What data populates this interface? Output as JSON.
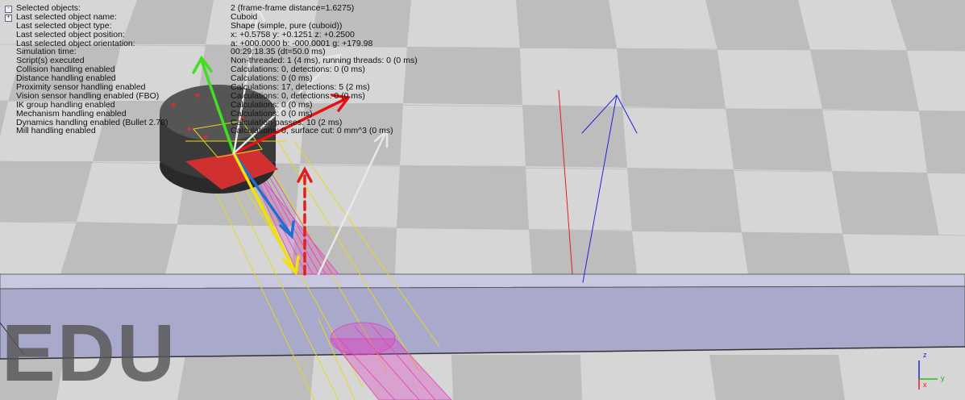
{
  "info_panel": {
    "rows": [
      {
        "label": "Selected objects:",
        "value": "2 (frame-frame distance=1.6275)",
        "toggle": "-"
      },
      {
        "label": "Last selected object name:",
        "value": "Cuboid",
        "toggle": "+"
      },
      {
        "label": "Last selected object type:",
        "value": "Shape (simple, pure (cuboid))"
      },
      {
        "label": "Last selected object position:",
        "value": "x: +0.5758    y: +0.1251    z: +0.2500"
      },
      {
        "label": "Last selected object orientation:",
        "value": "a: +000.0000    b: -000.0001    g: +179.98"
      },
      {
        "label": "Simulation time:",
        "value": "00:29:18.35 (dt=50.0 ms)"
      },
      {
        "label": "Script(s) executed",
        "value": "Non-threaded: 1 (4 ms), running threads: 0 (0 ms)"
      },
      {
        "label": "Collision handling enabled",
        "value": "Calculations: 0, detections: 0 (0 ms)"
      },
      {
        "label": "Distance handling enabled",
        "value": "Calculations: 0 (0 ms)"
      },
      {
        "label": "Proximity sensor handling enabled",
        "value": "Calculations: 17, detections: 5 (2 ms)"
      },
      {
        "label": "Vision sensor handling enabled (FBO)",
        "value": "Calculations: 0, detections: 0 (0 ms)"
      },
      {
        "label": "IK group handling enabled",
        "value": "Calculations: 0 (0 ms)"
      },
      {
        "label": "Mechanism handling enabled",
        "value": "Calculations: 0 (0 ms)"
      },
      {
        "label": "Dynamics handling enabled (Bullet 2.78)",
        "value": "Calculation passes: 10 (2 ms)"
      },
      {
        "label": "Mill handling enabled",
        "value": "Calculations: 0, surface cut: 0 mm^3 (0 ms)"
      }
    ]
  },
  "watermark": "EDU",
  "axis_gizmo": {
    "z": "z",
    "y": "y",
    "x": "x"
  },
  "colors": {
    "floor_light": "#dcdcdc",
    "floor_dark": "#bdbdbd",
    "conveyor": "#a8a8c8",
    "sensor_cone": "#e040c0",
    "sensor_rays": "#f0e020",
    "robot_red": "#d03030"
  }
}
